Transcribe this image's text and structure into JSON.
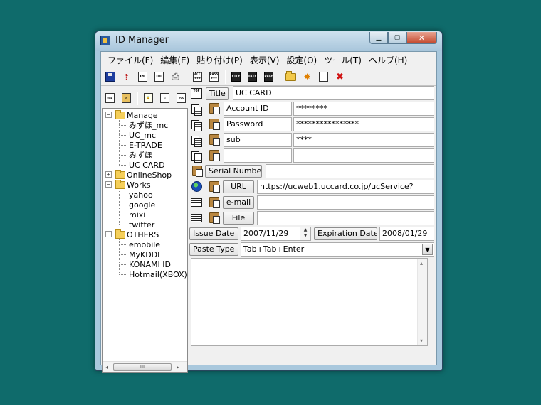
{
  "window": {
    "title": "ID Manager"
  },
  "menu": [
    "ファイル(F)",
    "編集(E)",
    "貼り付け(P)",
    "表示(V)",
    "設定(O)",
    "ツール(T)",
    "ヘルプ(H)"
  ],
  "toolbar_icons": {
    "acc": "ACC\n+++",
    "pass": "PASS\n+++",
    "file": "FILE",
    "date": "DATE",
    "page": "PAGE",
    "xml1": "XML",
    "xml2": "XML"
  },
  "tree": {
    "groups": [
      {
        "name": "Manage",
        "expanded": true,
        "items": [
          "みずほ_mc",
          "UC_mc",
          "E-TRADE",
          "みずほ",
          "UC CARD"
        ]
      },
      {
        "name": "OnlineShop",
        "expanded": false,
        "items": []
      },
      {
        "name": "Works",
        "expanded": true,
        "items": [
          "yahoo",
          "google",
          "mixi",
          "twitter"
        ]
      },
      {
        "name": "OTHERS",
        "expanded": true,
        "items": [
          "emobile",
          "MyKDDI",
          "KONAMI ID",
          "Hotmail(XBOX)"
        ]
      }
    ],
    "scroll_thumb": "III"
  },
  "form": {
    "title_label": "Title",
    "title_value": "UC CARD",
    "fields": [
      {
        "name": "Account ID",
        "value": "********"
      },
      {
        "name": "Password",
        "value": "****************"
      },
      {
        "name": "sub",
        "value": "****"
      },
      {
        "name": "",
        "value": ""
      }
    ],
    "serial_label": "Serial Number",
    "serial_value": "",
    "url_label": "URL",
    "url_value": "https://ucweb1.uccard.co.jp/ucService?",
    "email_label": "e-mail",
    "email_value": "",
    "file_label": "File",
    "file_value": "",
    "issue_label": "Issue Date",
    "issue_value": "2007/11/29",
    "expiration_label": "Expiration Date",
    "expiration_value": "2008/01/29",
    "paste_type_label": "Paste Type",
    "paste_type_value": "Tab+Tab+Enter",
    "notes": ""
  },
  "colors": {
    "desktop": "#0f6b6b",
    "window_frame": "#a9c8dd",
    "face": "#f0f0f0"
  }
}
